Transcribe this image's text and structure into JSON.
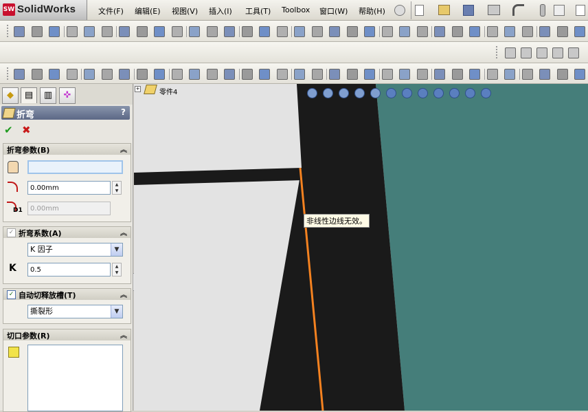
{
  "app": {
    "name": "SolidWorks",
    "logo_text": "SW"
  },
  "menus": [
    "文件(F)",
    "编辑(E)",
    "视图(V)",
    "插入(I)",
    "工具(T)",
    "Toolbox",
    "窗口(W)",
    "帮助(H)"
  ],
  "tree": {
    "part_name": "零件4"
  },
  "panel": {
    "tabs": [
      "feature-manager",
      "property-manager",
      "configuration-manager",
      "dim-xpert-manager"
    ],
    "title": "折弯",
    "help": "?",
    "ok": "✔",
    "cancel": "✖",
    "bend_params": {
      "header": "折弯参数(B)",
      "edge_value": "",
      "radius_value": "0.00mm",
      "d1_label": "D1",
      "d1_value": "0.00mm"
    },
    "bend_allowance": {
      "header": "折弯系数(A)",
      "checked": true,
      "type_value": "K 因子",
      "k_label": "K",
      "k_value": "0.5"
    },
    "auto_relief": {
      "header": "自动切释放槽(T)",
      "checked": true,
      "type_value": "撕裂形"
    },
    "cut_params": {
      "header": "切口参数(R)"
    }
  },
  "viewport": {
    "tooltip": "非线性边线无效。",
    "colors": {
      "background": "#e3e3e3",
      "teal": "#457e7a",
      "dark": "#1a1a1a",
      "edge": "#f58220"
    }
  }
}
